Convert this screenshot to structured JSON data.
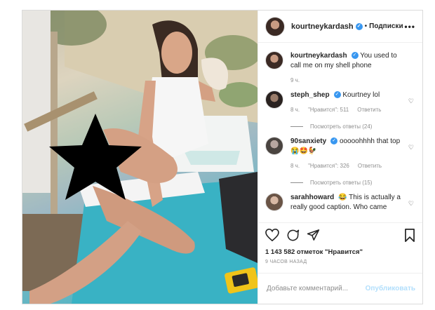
{
  "header": {
    "username": "kourtneykardash",
    "dot": "•",
    "follow_label": "Подписки",
    "more_label": "•••"
  },
  "caption": {
    "username": "kourtneykardash",
    "text": "You used to call me on my shell phone",
    "time": "9 ч."
  },
  "comments": [
    {
      "username": "steph_shep",
      "text": "Kourtney lol",
      "time": "8 ч.",
      "likes": "\"Нравится\": 511",
      "reply_label": "Ответить",
      "replies_label": "Посмотреть ответы (24)"
    },
    {
      "username": "90sanxiety",
      "text": "ooooohhhh that top 😭🤩🐓",
      "time": "8 ч.",
      "likes": "\"Нравится\": 326",
      "reply_label": "Ответить",
      "replies_label": "Посмотреть ответы (15)"
    },
    {
      "username": "sarahhoward",
      "text": "😂 This is actually a really good caption. Who came"
    }
  ],
  "likes_text": "1 143 582 отметок \"Нравится\"",
  "timestamp": "9 ЧАСОВ НАЗАД",
  "add_comment": {
    "placeholder": "Добавьте комментарий...",
    "publish_label": "Опубликовать"
  },
  "verified_mark": "✓",
  "colors": {
    "accent": "#3897f0",
    "publish_disabled": "#b2dffc",
    "towel": "#39b2c4"
  }
}
